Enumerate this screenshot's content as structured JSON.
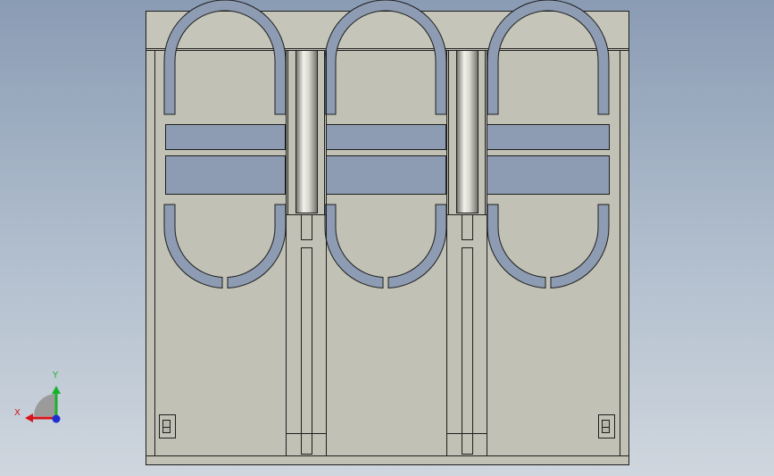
{
  "triad": {
    "x_label": "X",
    "y_label": "Y",
    "colors": {
      "x": "#d4161b",
      "y": "#17b32a",
      "z": "#1c2ed0"
    }
  },
  "model": {
    "face_color": "#c2c1b5",
    "cutout_color": "#8d9cb2",
    "edge_color": "#1e1e1e",
    "pin_highlight": "#f2f2ea",
    "pin_shadow": "#6f6f67"
  }
}
